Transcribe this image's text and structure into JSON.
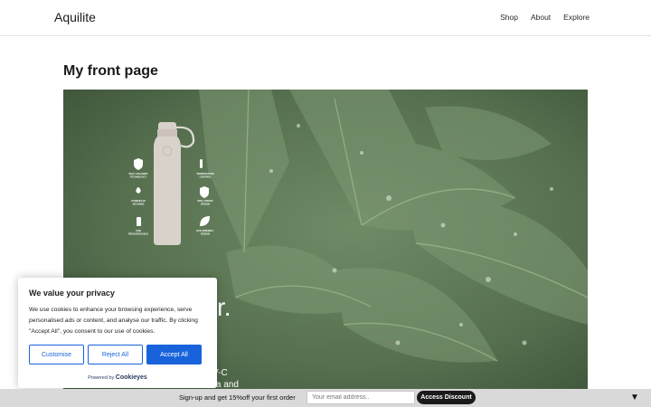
{
  "header": {
    "brand": "Aquilite",
    "nav": [
      {
        "label": "Shop"
      },
      {
        "label": "About"
      },
      {
        "label": "Explore"
      }
    ]
  },
  "page": {
    "title": "My front page"
  },
  "hero": {
    "headline_fragment": "r.",
    "subtext_line1": "V-C",
    "subtext_line2": "teria and",
    "features": [
      {
        "line1": "SELF-CLEANING",
        "line2": "TECHNOLOGY",
        "icon": "shield-check-icon"
      },
      {
        "line1": "TEMPERATURE",
        "line2": "CONTROL",
        "icon": "thermometer-icon"
      },
      {
        "line1": "PURIFIES IN",
        "line2": "SECONDS",
        "icon": "droplet-icon"
      },
      {
        "line1": "SPILL-PROOF",
        "line2": "DESIGN",
        "icon": "shield-drop-icon"
      },
      {
        "line1": "USB",
        "line2": "RECHARGEABLE",
        "icon": "battery-icon"
      },
      {
        "line1": "ECO-FRIENDLY",
        "line2": "DESIGN",
        "icon": "leaf-icon"
      }
    ]
  },
  "cookie_banner": {
    "title": "We value your privacy",
    "description": "We use cookies to enhance your browsing experience, serve personalised ads or content, and analyse our traffic. By clicking \"Accept All\", you consent to our use of cookies.",
    "customise_label": "Customise",
    "reject_label": "Reject All",
    "accept_label": "Accept All",
    "powered_by": "Powered by",
    "powered_brand": "Cookieyes",
    "accent_color": "#1863dc"
  },
  "signup_bar": {
    "text": "Sign-up and get 15%off your first order",
    "input_placeholder": "Your email address..",
    "button_label": "Access Discount",
    "collapse_icon": "triangle-down-icon"
  }
}
